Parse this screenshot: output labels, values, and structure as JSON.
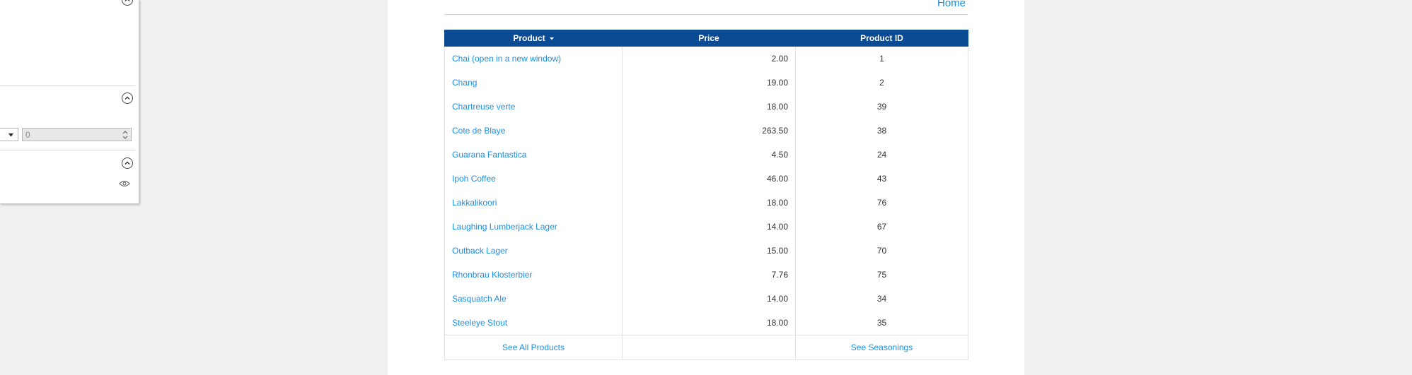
{
  "left_panel": {
    "number_value": "0"
  },
  "header": {
    "home_link": "Home"
  },
  "table": {
    "columns": [
      "Product",
      "Price",
      "Product ID"
    ],
    "sort_column": "Product",
    "rows": [
      {
        "product": "Chai  (open in a new window)",
        "price": "2.00",
        "id": "1"
      },
      {
        "product": "Chang",
        "price": "19.00",
        "id": "2"
      },
      {
        "product": "Chartreuse verte",
        "price": "18.00",
        "id": "39"
      },
      {
        "product": "Cote de Blaye",
        "price": "263.50",
        "id": "38"
      },
      {
        "product": "Guarana Fantastica",
        "price": "4.50",
        "id": "24"
      },
      {
        "product": "Ipoh Coffee",
        "price": "46.00",
        "id": "43"
      },
      {
        "product": "Lakkalikoori",
        "price": "18.00",
        "id": "76"
      },
      {
        "product": "Laughing Lumberjack Lager",
        "price": "14.00",
        "id": "67"
      },
      {
        "product": "Outback Lager",
        "price": "15.00",
        "id": "70"
      },
      {
        "product": "Rhonbrau Klosterbier",
        "price": "7.76",
        "id": "75"
      },
      {
        "product": "Sasquatch Ale",
        "price": "14.00",
        "id": "34"
      },
      {
        "product": "Steeleye Stout",
        "price": "18.00",
        "id": "35"
      }
    ],
    "footer": {
      "see_all_products": "See All Products",
      "see_seasonings": "See Seasonings"
    }
  },
  "colors": {
    "header_bg": "#0b4b93",
    "link": "#1a8fe5"
  }
}
